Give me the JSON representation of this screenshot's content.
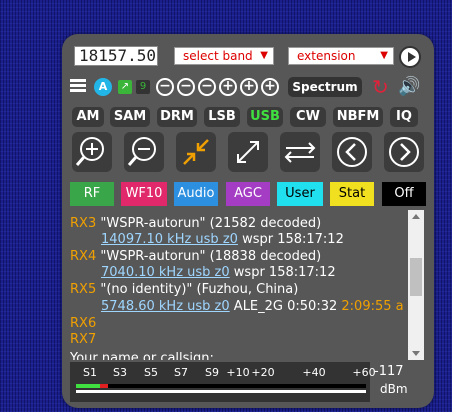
{
  "frequency": "18157.50",
  "select_band": "select band",
  "extension": "extension",
  "row2": {
    "a_label": "A",
    "nine_label": "9",
    "zoom_buttons": [
      "−",
      "−",
      "−",
      "+",
      "+",
      "+"
    ],
    "spectrum": "Spectrum"
  },
  "modes": [
    "AM",
    "SAM",
    "DRM",
    "LSB",
    "USB",
    "CW",
    "NBFM",
    "IQ"
  ],
  "active_mode": "USB",
  "tabs": [
    {
      "label": "RF",
      "bg": "#3aa64a",
      "fg": "#ffffff"
    },
    {
      "label": "WF10",
      "bg": "#e0286a",
      "fg": "#ffffff"
    },
    {
      "label": "Audio",
      "bg": "#2c8fe0",
      "fg": "#ffffff"
    },
    {
      "label": "AGC",
      "bg": "#a43cc4",
      "fg": "#ffffff"
    },
    {
      "label": "User",
      "bg": "#20e0f0",
      "fg": "#000000"
    },
    {
      "label": "Stat",
      "bg": "#f0e020",
      "fg": "#000000"
    },
    {
      "label": "Off",
      "bg": "#000000",
      "fg": "#ffffff"
    }
  ],
  "log": {
    "rx3_label": "RX3",
    "rx3_title": "\"WSPR-autorun\" (21582 decoded)",
    "rx3_link": "14097.10 kHz usb z0",
    "rx3_tail": "wspr 158:17:12",
    "rx4_label": "RX4",
    "rx4_title": "\"WSPR-autorun\" (18838 decoded)",
    "rx4_link": "7040.10 kHz usb z0",
    "rx4_tail": "wspr 158:17:12",
    "rx5_label": "RX5",
    "rx5_title": "\"(no identity)\" (Fuzhou, China)",
    "rx5_link": "5748.60 kHz usb z0",
    "rx5_tail": "ALE_2G 0:50:32",
    "rx5_time": "2:09:55 a",
    "rx6_label": "RX6",
    "rx7_label": "RX7",
    "callsign_prompt": "Your name or callsign:"
  },
  "smeter": {
    "ticks": [
      "S1",
      "S3",
      "S5",
      "S7",
      "S9",
      "+10",
      "+20",
      "+40",
      "+60"
    ],
    "value": "-117",
    "unit": "dBm"
  },
  "colors": {
    "panel": "#575757",
    "accent_red": "#d00000",
    "rx_label": "#f0a000",
    "link": "#9fd6ff"
  },
  "icons": [
    "zoom-in-icon",
    "zoom-out-icon",
    "zoom-to-band-icon",
    "zoom-max-icon",
    "toggle-link-icon",
    "step-back-icon",
    "step-forward-icon"
  ]
}
